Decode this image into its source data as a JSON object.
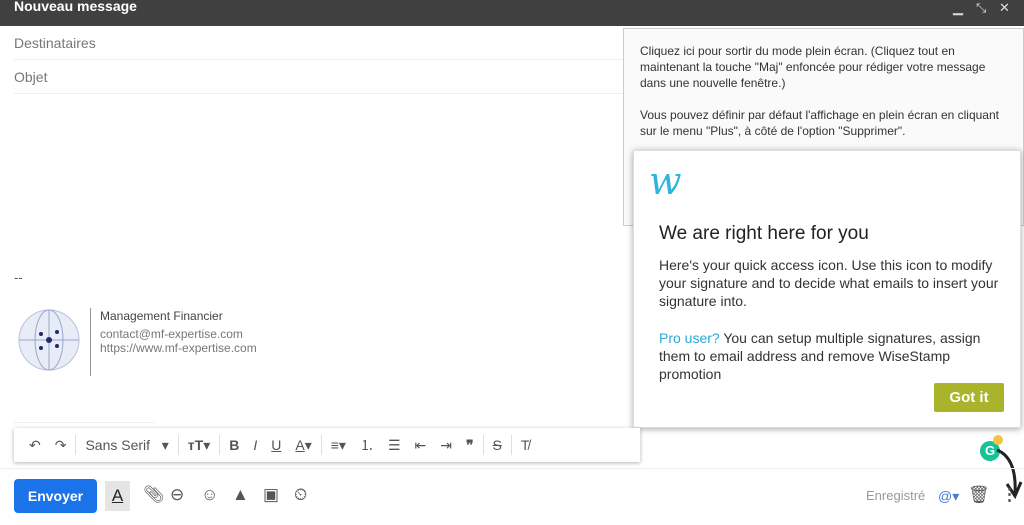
{
  "header": {
    "title": "Nouveau message",
    "controls": [
      "minimize-icon",
      "exit-fullscreen-icon",
      "close-icon"
    ]
  },
  "fields": {
    "recipients_placeholder": "Destinataires",
    "subject_placeholder": "Objet"
  },
  "tooltip": {
    "p1": "Cliquez ici pour sortir du mode plein écran. (Cliquez tout en maintenant la touche \"Maj\" enfoncée pour rédiger votre message dans une nouvelle fenêtre.)",
    "p2": "Vous pouvez définir par défaut l'affichage en plein écran en cliquant sur le menu \"Plus\", à côté de l'option \"Supprimer\"."
  },
  "wisestamp": {
    "logo": "W",
    "title": "We are right here for you",
    "body1": "Here's your quick access icon. Use this icon to modify your signature and to decide what emails to insert your signature into.",
    "pro_link": "Pro user?",
    "body2": " You can setup multiple signatures, assign them to email address and remove WiseStamp promotion",
    "button": "Got it",
    "button_color": "#a9b42a"
  },
  "body": {
    "separator": "--",
    "signature": {
      "name": "Management Financier",
      "email": "contact@mf-expertise.com",
      "url": "https://www.mf-expertise.com"
    }
  },
  "format_toolbar": {
    "font": "Sans Serif"
  },
  "bottom": {
    "send": "Envoyer",
    "status": "Enregistré",
    "send_color": "#1a73e8"
  }
}
